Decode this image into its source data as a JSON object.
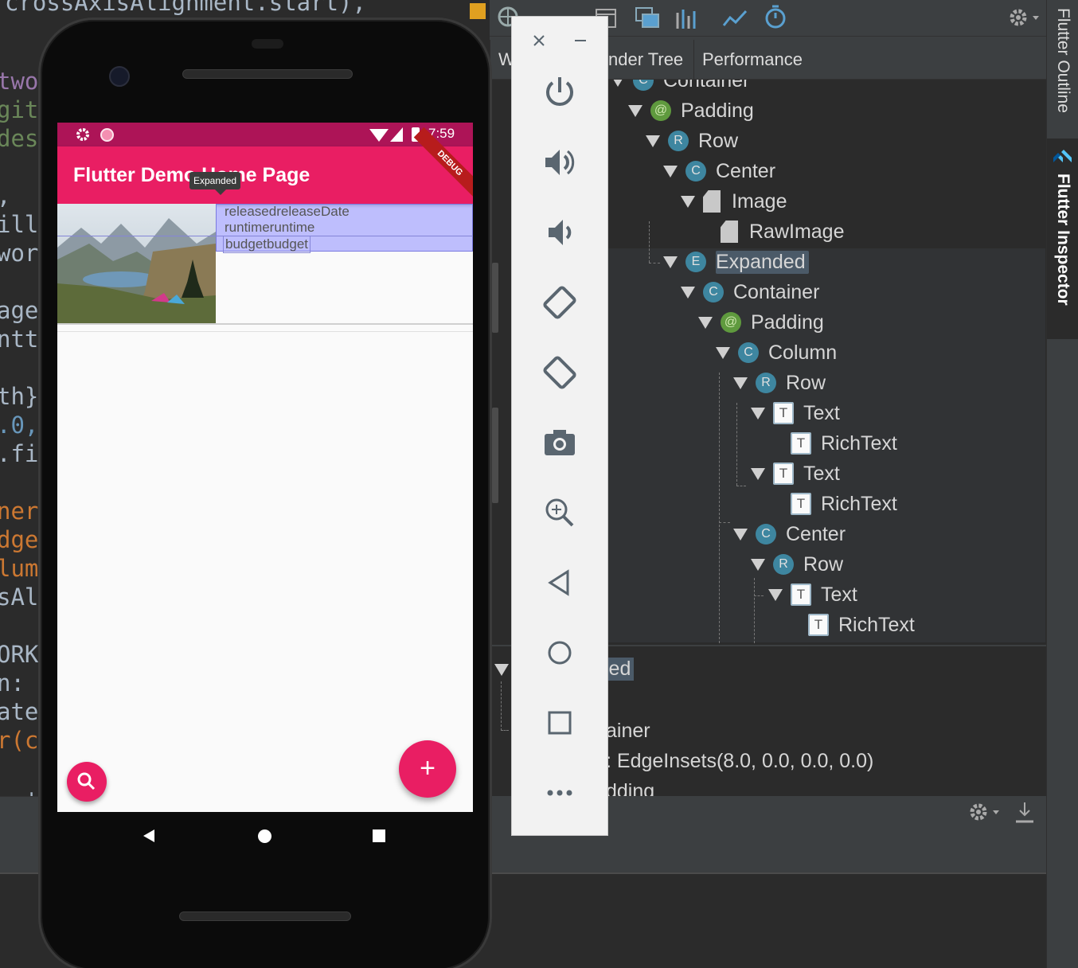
{
  "editor": {
    "top_line": "crossAxisAlignment.start),",
    "lines": [
      {
        "text": "two",
        "cls": "purp"
      },
      {
        "text": "git",
        "cls": "grn"
      },
      {
        "text": "des",
        "cls": "grn"
      },
      {
        "text": ",",
        "cls": ""
      },
      {
        "text": "ill",
        "cls": ""
      },
      {
        "text": "wor",
        "cls": ""
      },
      {
        "text": "age",
        "cls": ""
      },
      {
        "text": "ntt",
        "cls": ""
      },
      {
        "text": "th}'",
        "cls": ""
      },
      {
        "text": ".0,",
        "cls": "blu"
      },
      {
        "text": ".fi",
        "cls": ""
      },
      {
        "text": "ner",
        "cls": "yel"
      },
      {
        "text": "dge",
        "cls": "yel"
      },
      {
        "text": "lum",
        "cls": "yel"
      },
      {
        "text": "sAl",
        "cls": ""
      },
      {
        "text": "ORK",
        "cls": ""
      },
      {
        "text": "n: -",
        "cls": ""
      },
      {
        "text": "ate",
        "cls": ""
      },
      {
        "text": "r(c",
        "cls": "yel"
      },
      {
        "text": "__+-",
        "cls": ""
      }
    ]
  },
  "phone": {
    "status_time": "7:59",
    "app_title": "Flutter Demo Home Page",
    "tooltip": "Expanded",
    "debug_ribbon": "DEBUG",
    "rows": [
      "releasedreleaseDate",
      "runtimeruntime",
      "budgetbudget"
    ],
    "fab_label": "+",
    "colors": {
      "primary": "#e91e63",
      "status": "#ad1457"
    }
  },
  "emulator": {
    "buttons": [
      {
        "name": "close-icon"
      },
      {
        "name": "minimize-icon"
      },
      {
        "name": "power-icon"
      },
      {
        "name": "volume-up-icon"
      },
      {
        "name": "volume-down-icon"
      },
      {
        "name": "rotate-left-icon"
      },
      {
        "name": "rotate-right-icon"
      },
      {
        "name": "camera-icon"
      },
      {
        "name": "zoom-icon"
      },
      {
        "name": "back-icon"
      },
      {
        "name": "home-icon"
      },
      {
        "name": "overview-icon"
      },
      {
        "name": "more-icon"
      }
    ]
  },
  "inspector": {
    "tabs": [
      "W",
      "nder Tree",
      "Performance"
    ],
    "tree": [
      {
        "label": "Container",
        "badge": "C",
        "kind": "c",
        "depth": 0,
        "arrow": true
      },
      {
        "label": "Padding",
        "badge": "@",
        "kind": "at",
        "depth": 1,
        "arrow": true
      },
      {
        "label": "Row",
        "badge": "R",
        "kind": "r",
        "depth": 2,
        "arrow": true
      },
      {
        "label": "Center",
        "badge": "C",
        "kind": "c",
        "depth": 3,
        "arrow": true
      },
      {
        "label": "Image",
        "badge": "",
        "kind": "img",
        "depth": 4,
        "arrow": true
      },
      {
        "label": "RawImage",
        "badge": "",
        "kind": "img",
        "depth": 5,
        "arrow": false
      },
      {
        "label": "Expanded",
        "badge": "E",
        "kind": "e",
        "depth": 3,
        "arrow": true,
        "selected": true
      },
      {
        "label": "Container",
        "badge": "C",
        "kind": "c",
        "depth": 4,
        "arrow": true
      },
      {
        "label": "Padding",
        "badge": "@",
        "kind": "at",
        "depth": 5,
        "arrow": true
      },
      {
        "label": "Column",
        "badge": "C",
        "kind": "c",
        "depth": 6,
        "arrow": true
      },
      {
        "label": "Row",
        "badge": "R",
        "kind": "r",
        "depth": 7,
        "arrow": true
      },
      {
        "label": "Text",
        "badge": "T",
        "kind": "t",
        "depth": 8,
        "arrow": true
      },
      {
        "label": "RichText",
        "badge": "T",
        "kind": "t",
        "depth": 9,
        "arrow": false
      },
      {
        "label": "Text",
        "badge": "T",
        "kind": "t",
        "depth": 8,
        "arrow": true
      },
      {
        "label": "RichText",
        "badge": "T",
        "kind": "t",
        "depth": 9,
        "arrow": false
      },
      {
        "label": "Center",
        "badge": "C",
        "kind": "c",
        "depth": 7,
        "arrow": true
      },
      {
        "label": "Row",
        "badge": "R",
        "kind": "r",
        "depth": 8,
        "arrow": true
      },
      {
        "label": "Text",
        "badge": "T",
        "kind": "t",
        "depth": 9,
        "arrow": true
      },
      {
        "label": "RichText",
        "badge": "T",
        "kind": "t",
        "depth": 10,
        "arrow": false
      }
    ],
    "details": {
      "selected": "led",
      "line1": "ainer",
      "line2": ": EdgeInsets(8.0, 0.0, 0.0, 0.0)",
      "line3": "dding"
    },
    "side_tabs": [
      "Flutter Outline",
      "Flutter Inspector"
    ]
  }
}
